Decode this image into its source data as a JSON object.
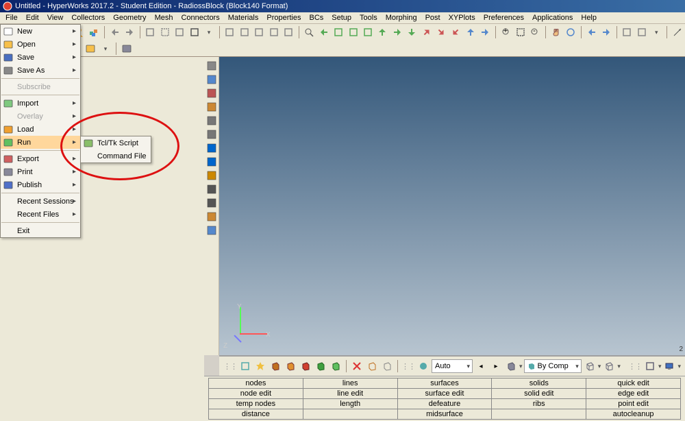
{
  "title": "Untitled - HyperWorks 2017.2 - Student Edition - RadiossBlock (Block140 Format)",
  "menubar": [
    "File",
    "Edit",
    "View",
    "Collectors",
    "Geometry",
    "Mesh",
    "Connectors",
    "Materials",
    "Properties",
    "BCs",
    "Setup",
    "Tools",
    "Morphing",
    "Post",
    "XYPlots",
    "Preferences",
    "Applications",
    "Help"
  ],
  "file_menu": {
    "items": [
      {
        "label": "New",
        "type": "new",
        "hasub": true
      },
      {
        "label": "Open",
        "type": "open",
        "hasub": true
      },
      {
        "label": "Save",
        "type": "save",
        "hasub": true
      },
      {
        "label": "Save As",
        "type": "saveas",
        "hasub": true
      },
      {
        "sep": true
      },
      {
        "label": "Subscribe",
        "disabled": true
      },
      {
        "sep": true
      },
      {
        "label": "Import",
        "type": "import",
        "hasub": true
      },
      {
        "label": "Overlay",
        "disabled": true,
        "hasub": true
      },
      {
        "label": "Load",
        "type": "load",
        "hasub": true
      },
      {
        "label": "Run",
        "type": "run",
        "hasub": true,
        "highlight": true
      },
      {
        "sep": true
      },
      {
        "label": "Export",
        "type": "export",
        "hasub": true
      },
      {
        "label": "Print",
        "type": "print",
        "hasub": true
      },
      {
        "label": "Publish",
        "type": "publish",
        "hasub": true
      },
      {
        "sep": true
      },
      {
        "label": "Recent Sessions",
        "hasub": true
      },
      {
        "label": "Recent Files",
        "hasub": true
      },
      {
        "sep": true
      },
      {
        "label": "Exit"
      }
    ]
  },
  "run_menu": {
    "items": [
      {
        "label": "Tcl/Tk Script",
        "type": "script"
      },
      {
        "label": "Command File"
      }
    ]
  },
  "side_icons": [
    "model-icon",
    "entity-icon",
    "mask-icon",
    "card-icon",
    "list-icon",
    "list2-icon",
    "info-icon",
    "count-icon",
    "measure-icon",
    "abc-icon",
    "abc2-icon",
    "plot-icon",
    "box-icon"
  ],
  "bottom_toolbar": {
    "auto_label": "Auto",
    "bycomp_label": "By Comp"
  },
  "axis": {
    "x": "X",
    "y": "Y",
    "z": "Z"
  },
  "viewport_num": "2",
  "panel_grid": [
    [
      "nodes",
      "lines",
      "surfaces",
      "solids",
      "quick edit"
    ],
    [
      "node edit",
      "line edit",
      "surface edit",
      "solid edit",
      "edge edit"
    ],
    [
      "temp nodes",
      "length",
      "defeature",
      "ribs",
      "point edit"
    ],
    [
      "distance",
      "",
      "midsurface",
      "",
      "autocleanup"
    ]
  ],
  "colors": {
    "highlight": "#ffd79c",
    "annot": "#d11"
  }
}
